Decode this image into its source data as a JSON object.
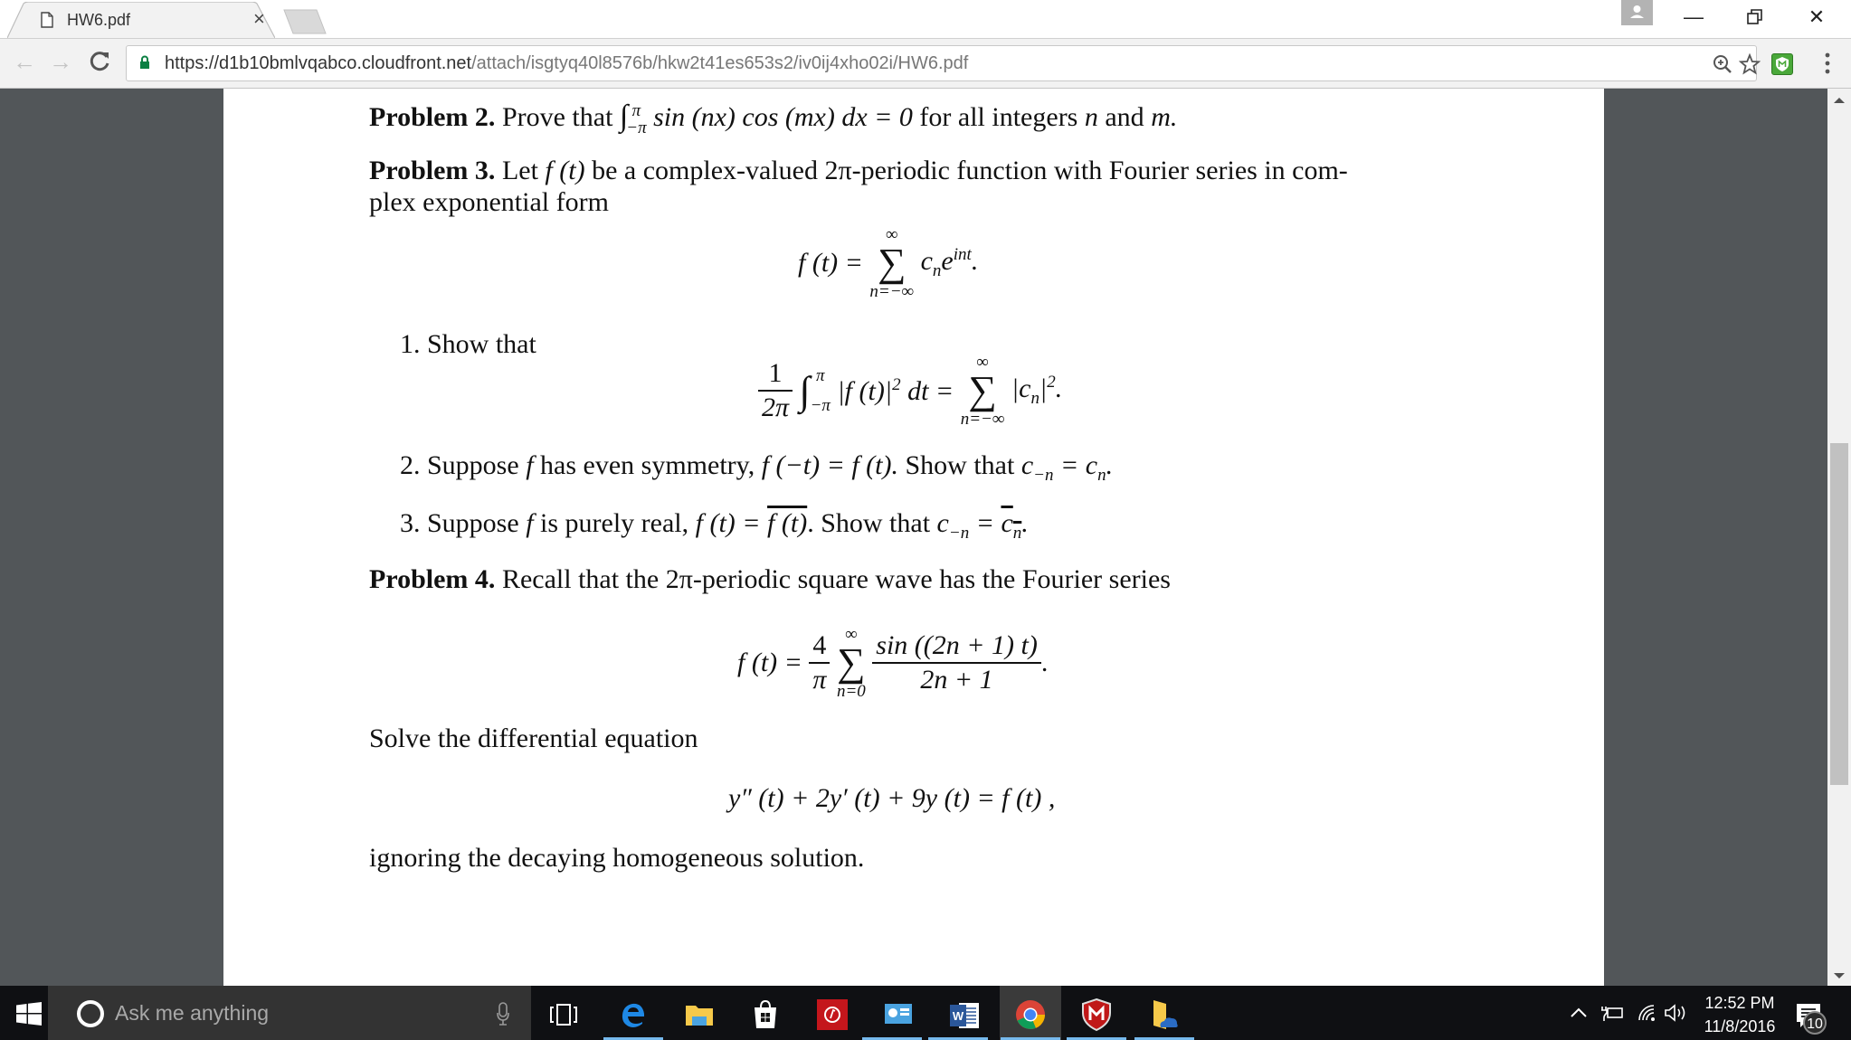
{
  "browser": {
    "tab": {
      "title": "HW6.pdf",
      "icon": "document-icon",
      "close_glyph": "×"
    },
    "window_controls": {
      "minimize": "—",
      "restore": "❐",
      "close": "✕"
    },
    "toolbar": {
      "back": "←",
      "forward": "→",
      "reload": "C",
      "url_host": "https://d1b10bmlvqabco.cloudfront.net",
      "url_path": "/attach/isgtyq40l8576b/hkw2t41es653s2/iv0ij4xho02i/HW6.pdf",
      "secure": true,
      "accent_secure": "#0b8043"
    }
  },
  "document": {
    "p2": {
      "label": "Problem 2.",
      "text_before": "Prove that",
      "int_upper": "π",
      "int_lower": "−π",
      "expr": "sin (nx) cos (mx) dx = 0",
      "text_after": "for all integers",
      "var_n": "n",
      "and": "and",
      "var_m": "m."
    },
    "p3": {
      "label": "Problem 3.",
      "line1_a": "Let",
      "line1_f": "f (t)",
      "line1_b": "be a complex-valued 2π-periodic function with Fourier series in com-",
      "line2": "plex exponential form",
      "eq1": {
        "lhs": "f (t) =",
        "sum_top": "∞",
        "sum": "∑",
        "sum_bottom": "n=−∞",
        "term": "c",
        "term_sub": "n",
        "term_e": "e",
        "term_sup": "int",
        "end": "."
      },
      "items": [
        {
          "num": "1.",
          "text": "Show that"
        },
        {
          "num": "2.",
          "text_a": "Suppose",
          "f": "f",
          "text_b": "has even symmetry,",
          "eq": "f (−t) = f (t).",
          "text_c": "Show that",
          "concl": "c",
          "concl_sub": "−n",
          "concl_eq": "=",
          "concl_rhs": "c",
          "concl_rhs_sub": "n",
          "end": "."
        },
        {
          "num": "3.",
          "text_a": "Suppose",
          "f": "f",
          "text_b": "is purely real,",
          "eq_lhs": "f (t) =",
          "eq_rhs_over": "f (t)",
          "dot": ".",
          "text_c": "Show that",
          "concl": "c",
          "concl_sub": "−n",
          "concl_eq": "=",
          "concl_rhs_over": "c",
          "concl_rhs_sub": "n",
          "end": "."
        }
      ],
      "eq2": {
        "frac_num": "1",
        "frac_den": "2π",
        "int_upper": "π",
        "int_lower": "−π",
        "integrand": "|f (t)|",
        "sq": "2",
        "dt": "dt =",
        "sum_top": "∞",
        "sum": "∑",
        "sum_bottom": "n=−∞",
        "rhs": "|c",
        "rhs_sub": "n",
        "rhs_close": "|",
        "rhs_sq": "2",
        "end": "."
      }
    },
    "p4": {
      "label": "Problem 4.",
      "text": "Recall that the 2π-periodic square wave has the Fourier series",
      "eq3": {
        "lhs": "f (t) =",
        "frac_num": "4",
        "frac_den": "π",
        "sum_top": "∞",
        "sum": "∑",
        "sum_bottom": "n=0",
        "num": "sin ((2n + 1) t)",
        "den": "2n + 1",
        "end": "."
      },
      "solve": "Solve the differential equation",
      "ode": "y″ (t) + 2y′ (t) + 9y (t) = f (t) ,",
      "ignoring": "ignoring the decaying homogeneous solution."
    }
  },
  "scrollbar": {
    "position_fraction": 0.42,
    "visible_fraction": 0.38
  },
  "taskbar": {
    "search_placeholder": "Ask me anything",
    "apps": [
      {
        "name": "task-view",
        "active": false
      },
      {
        "name": "edge",
        "active": false
      },
      {
        "name": "file-explorer",
        "active": false
      },
      {
        "name": "store",
        "active": false
      },
      {
        "name": "music-app",
        "active": false
      },
      {
        "name": "control-panel",
        "active": false
      },
      {
        "name": "word",
        "active": false
      },
      {
        "name": "chrome",
        "active": true
      },
      {
        "name": "mcafee",
        "active": false
      },
      {
        "name": "onedrive-folder",
        "active": false
      }
    ],
    "time": "12:52 PM",
    "date": "11/8/2016",
    "notification_count": "10"
  }
}
